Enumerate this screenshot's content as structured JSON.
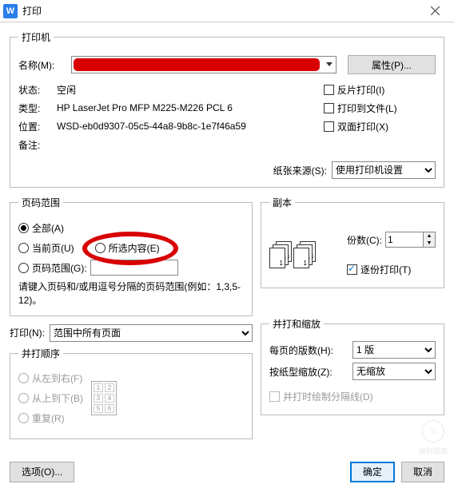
{
  "titlebar": {
    "icon_text": "W",
    "title": "打印"
  },
  "printer": {
    "legend": "打印机",
    "name_label": "名称(M):",
    "props_btn": "属性(P)...",
    "status_label": "状态:",
    "status_value": "空闲",
    "type_label": "类型:",
    "type_value": "HP LaserJet Pro MFP M225-M226 PCL 6",
    "where_label": "位置:",
    "where_value": "WSD-eb0d9307-05c5-44a8-9b8c-1e7f46a59",
    "comment_label": "备注:",
    "chk_mirror": "反片打印(I)",
    "chk_tofile": "打印到文件(L)",
    "chk_duplex": "双面打印(X)",
    "source_label": "纸张来源(S):",
    "source_value": "使用打印机设置"
  },
  "range": {
    "legend": "页码范围",
    "all": "全部(A)",
    "current": "当前页(U)",
    "selection": "所选内容(E)",
    "pages": "页码范围(G):",
    "hint": "请键入页码和/或用逗号分隔的页码范围(例如：1,3,5-12)。"
  },
  "copies": {
    "legend": "副本",
    "num_label": "份数(C):",
    "num_value": "1",
    "collate": "逐份打印(T)"
  },
  "print_what": {
    "label": "打印(N):",
    "value": "范围中所有页面"
  },
  "order": {
    "legend": "并打顺序",
    "lr": "从左到右(F)",
    "tb": "从上到下(B)",
    "repeat": "重复(R)"
  },
  "scale": {
    "legend": "并打和缩放",
    "pages_per_label": "每页的版数(H):",
    "pages_per_value": "1 版",
    "scale_label": "按纸型缩放(Z):",
    "scale_value": "无缩放",
    "separator": "并打时绘制分隔线(D)"
  },
  "footer": {
    "options": "选项(O)...",
    "ok": "确定",
    "cancel": "取消"
  },
  "watermark": "搜狗指南"
}
